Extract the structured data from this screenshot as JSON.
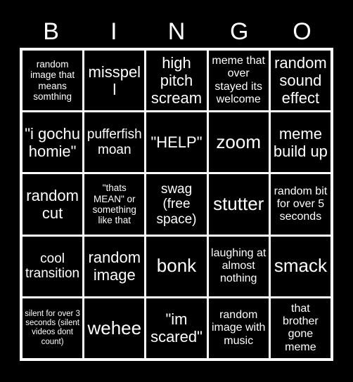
{
  "card": {
    "background_color": "#000000",
    "grid_line_color": "#ffffff",
    "cell_color": "#000000",
    "text_color": "#ffffff",
    "header": {
      "letters": [
        "B",
        "I",
        "N",
        "G",
        "O"
      ]
    },
    "rows": [
      [
        {
          "text": "random image that means somthing",
          "size": "sm"
        },
        {
          "text": "misspell",
          "size": "xl"
        },
        {
          "text": "high pitch scream",
          "size": "xl"
        },
        {
          "text": "meme that over stayed its welcome",
          "size": "md"
        },
        {
          "text": "random sound effect",
          "size": "xl"
        }
      ],
      [
        {
          "text": "\"i gochu homie\"",
          "size": "xl"
        },
        {
          "text": "pufferfish moan",
          "size": "lg"
        },
        {
          "text": "\"HELP\"",
          "size": "xl"
        },
        {
          "text": "zoom",
          "size": "xxl"
        },
        {
          "text": "meme build up",
          "size": "xl"
        }
      ],
      [
        {
          "text": "random cut",
          "size": "xl"
        },
        {
          "text": "\"thats MEAN\" or something like that",
          "size": "sm"
        },
        {
          "text": "swag (free space)",
          "size": "lg"
        },
        {
          "text": "stutter",
          "size": "xxl"
        },
        {
          "text": "random bit for over 5 seconds",
          "size": "md"
        }
      ],
      [
        {
          "text": "cool transition",
          "size": "lg"
        },
        {
          "text": "random image",
          "size": "xl"
        },
        {
          "text": "bonk",
          "size": "xxl"
        },
        {
          "text": "laughing at almost nothing",
          "size": "md"
        },
        {
          "text": "smack",
          "size": "xxl"
        }
      ],
      [
        {
          "text": "silent for over 3 seconds (silent videos dont count)",
          "size": "xs"
        },
        {
          "text": "wehee",
          "size": "xxl"
        },
        {
          "text": "\"im scared\"",
          "size": "xl"
        },
        {
          "text": "random image with music",
          "size": "md"
        },
        {
          "text": "that brother gone meme",
          "size": "md"
        }
      ]
    ]
  }
}
